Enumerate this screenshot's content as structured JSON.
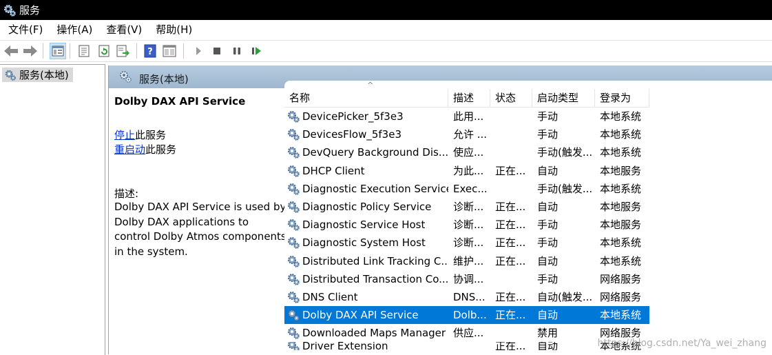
{
  "window": {
    "title": "服务"
  },
  "menu": [
    "文件(F)",
    "操作(A)",
    "查看(V)",
    "帮助(H)"
  ],
  "toolbar_icons": [
    "back-arrow-icon",
    "forward-arrow-icon",
    "console-tree-icon",
    "properties-icon",
    "refresh-icon",
    "export-list-icon",
    "help-icon",
    "action-pane-icon",
    "start-service-icon",
    "stop-service-icon",
    "pause-service-icon",
    "restart-service-icon"
  ],
  "tree": {
    "item": "服务(本地)"
  },
  "section": {
    "title": "服务(本地)"
  },
  "detail": {
    "service_name": "Dolby DAX API Service",
    "stop_link": "停止",
    "stop_suffix": "此服务",
    "restart_link": "重启动",
    "restart_suffix": "此服务",
    "desc_label": "描述:",
    "description": "Dolby DAX API Service is used by Dolby DAX applications to control Dolby Atmos components in the system."
  },
  "list": {
    "columns": [
      "名称",
      "描述",
      "状态",
      "启动类型",
      "登录为"
    ],
    "sort_indicator": "^",
    "rows": [
      {
        "name": "DevicePicker_5f3e3",
        "desc": "此用...",
        "status": "",
        "start": "手动",
        "logon": "本地系统"
      },
      {
        "name": "DevicesFlow_5f3e3",
        "desc": "允许 ...",
        "status": "",
        "start": "手动",
        "logon": "本地系统"
      },
      {
        "name": "DevQuery Background Dis...",
        "desc": "使应...",
        "status": "",
        "start": "手动(触发...",
        "logon": "本地系统"
      },
      {
        "name": "DHCP Client",
        "desc": "为此...",
        "status": "正在...",
        "start": "自动",
        "logon": "本地服务"
      },
      {
        "name": "Diagnostic Execution Service",
        "desc": "Exec...",
        "status": "",
        "start": "手动(触发...",
        "logon": "本地系统"
      },
      {
        "name": "Diagnostic Policy Service",
        "desc": "诊断...",
        "status": "正在...",
        "start": "自动",
        "logon": "本地服务"
      },
      {
        "name": "Diagnostic Service Host",
        "desc": "诊断...",
        "status": "正在...",
        "start": "手动",
        "logon": "本地服务"
      },
      {
        "name": "Diagnostic System Host",
        "desc": "诊断...",
        "status": "正在...",
        "start": "手动",
        "logon": "本地系统"
      },
      {
        "name": "Distributed Link Tracking C...",
        "desc": "维护...",
        "status": "正在...",
        "start": "自动",
        "logon": "本地系统"
      },
      {
        "name": "Distributed Transaction Co...",
        "desc": "协调...",
        "status": "",
        "start": "手动",
        "logon": "网络服务"
      },
      {
        "name": "DNS Client",
        "desc": "DNS...",
        "status": "正在...",
        "start": "自动(触发...",
        "logon": "网络服务"
      },
      {
        "name": "Dolby DAX API Service",
        "desc": "Dolb...",
        "status": "正在...",
        "start": "自动",
        "logon": "本地系统",
        "selected": true
      },
      {
        "name": "Downloaded Maps Manager",
        "desc": "供应...",
        "status": "",
        "start": "禁用",
        "logon": "网络服务"
      },
      {
        "name": "Driver Extension",
        "desc": "",
        "status": "正在...",
        "start": "自动",
        "logon": "本地系统"
      }
    ]
  },
  "watermark": "https://blog.csdn.net/Ya_wei_zhang",
  "colors": {
    "selection": "#0078d7",
    "header_band": "#a9c0d6",
    "link": "#0033cc",
    "titlebar": "#000000"
  }
}
